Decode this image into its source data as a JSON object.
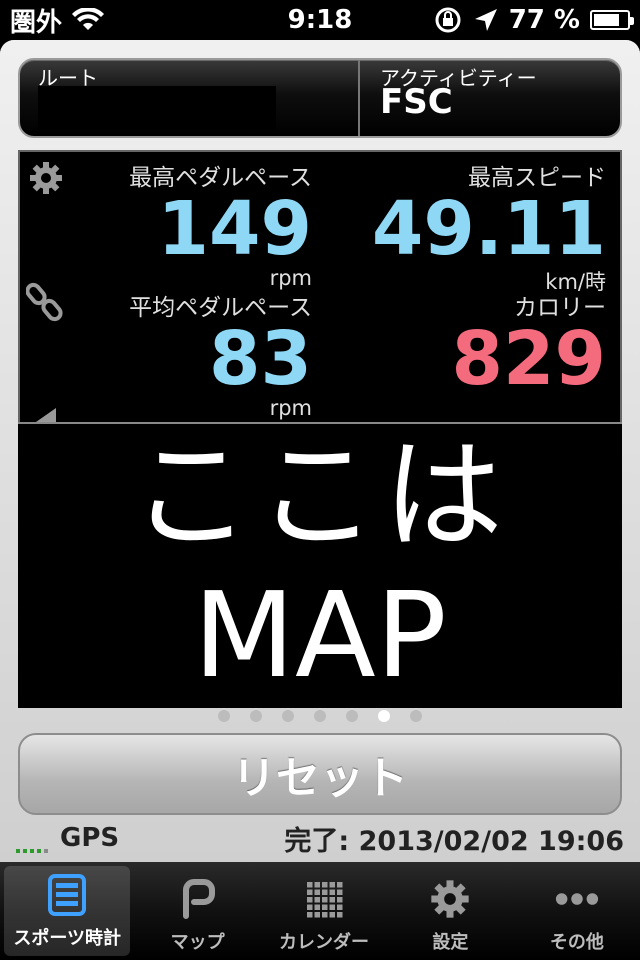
{
  "status_bar": {
    "carrier": "圏外",
    "time": "9:18",
    "battery": "77 %",
    "battery_level": 0.77,
    "icons": [
      "wifi-icon",
      "orientation-lock-icon",
      "location-icon",
      "battery-icon"
    ]
  },
  "header": {
    "route_label": "ルート",
    "route_value": "",
    "activity_label": "アクティビティー",
    "activity_value": "FSC"
  },
  "stats": {
    "max_cadence": {
      "label": "最高ペダルペース",
      "value": "149",
      "unit": "rpm"
    },
    "max_speed": {
      "label": "最高スピード",
      "value": "49.11",
      "unit": "km/時"
    },
    "avg_cadence": {
      "label": "平均ペダルペース",
      "value": "83",
      "unit": "rpm"
    },
    "calories": {
      "label": "カロリー",
      "value": "829"
    }
  },
  "map": {
    "line1": "ここは",
    "line2": "MAP"
  },
  "page_indicator": {
    "count": 7,
    "active_index": 5
  },
  "reset_label": "リセット",
  "footer": {
    "gps_label": "GPS",
    "done_label": "完了:",
    "done_datetime": "2013/02/02 19:06"
  },
  "tabs": [
    {
      "label": "スポーツ時計",
      "icon": "stopwatch-icon",
      "active": true
    },
    {
      "label": "マップ",
      "icon": "route-icon",
      "active": false
    },
    {
      "label": "カレンダー",
      "icon": "calendar-grid-icon",
      "active": false
    },
    {
      "label": "設定",
      "icon": "gear-icon",
      "active": false
    },
    {
      "label": "その他",
      "icon": "more-dots-icon",
      "active": false
    }
  ],
  "colors": {
    "value_blue": "#8fd8f5",
    "value_red": "#f46b7e",
    "active_tab_icon": "#3ea0ff",
    "gps_signal": "#2c9b2c"
  }
}
